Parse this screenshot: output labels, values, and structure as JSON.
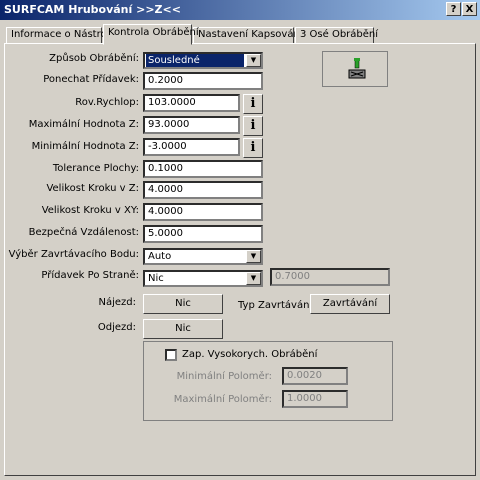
{
  "window": {
    "title": "SURFCAM Hrubování >>Z<<",
    "help_label": "?",
    "close_label": "X"
  },
  "tabs": [
    {
      "label": "Informace o Nástroji"
    },
    {
      "label": "Kontrola Obrábění"
    },
    {
      "label": "Nastavení Kapsování"
    },
    {
      "label": "3 Osé Obrábění"
    }
  ],
  "form": {
    "zpusob_label": "Způsob Obrábění:",
    "zpusob_value": "Sousledné",
    "ponechat_label": "Ponechat Přídavek:",
    "ponechat_value": "0.2000",
    "rov_label": "Rov.Rychlop:",
    "rov_value": "103.0000",
    "maxz_label": "Maximální Hodnota Z:",
    "maxz_value": "93.0000",
    "minz_label": "Minimální Hodnota Z:",
    "minz_value": "-3.0000",
    "tol_label": "Tolerance Plochy:",
    "tol_value": "0.1000",
    "krokz_label": "Velikost Kroku v Z:",
    "krokz_value": "4.0000",
    "krokxy_label": "Velikost Kroku v XY:",
    "krokxy_value": "4.0000",
    "bezp_label": "Bezpečná Vzdálenost:",
    "bezp_value": "5.0000",
    "vyber_label": "Výběr Zavrtávacího Bodu:",
    "vyber_value": "Auto",
    "pridavek_label": "Přídavek Po Straně:",
    "pridavek_value": "Nic",
    "pridavek_disabled_value": "0.7000",
    "info_label": "i",
    "najezd_label": "Nájezd:",
    "najezd_button": "Nic",
    "typ_label": "Typ Zavrtávání:",
    "typ_button": "Zavrtávání",
    "odjezd_label": "Odjezd:",
    "odjezd_button": "Nic"
  },
  "hsm": {
    "checkbox_label": "Zap. Vysokorych. Obrábění",
    "checked": false,
    "min_label": "Minimální Poloměr:",
    "min_value": "0.0020",
    "max_label": "Maximální Poloměr:",
    "max_value": "1.0000"
  },
  "colors": {
    "title_start": "#0a246a",
    "title_end": "#a6caf0",
    "face": "#d4d0c8",
    "selection": "#0a246a"
  }
}
